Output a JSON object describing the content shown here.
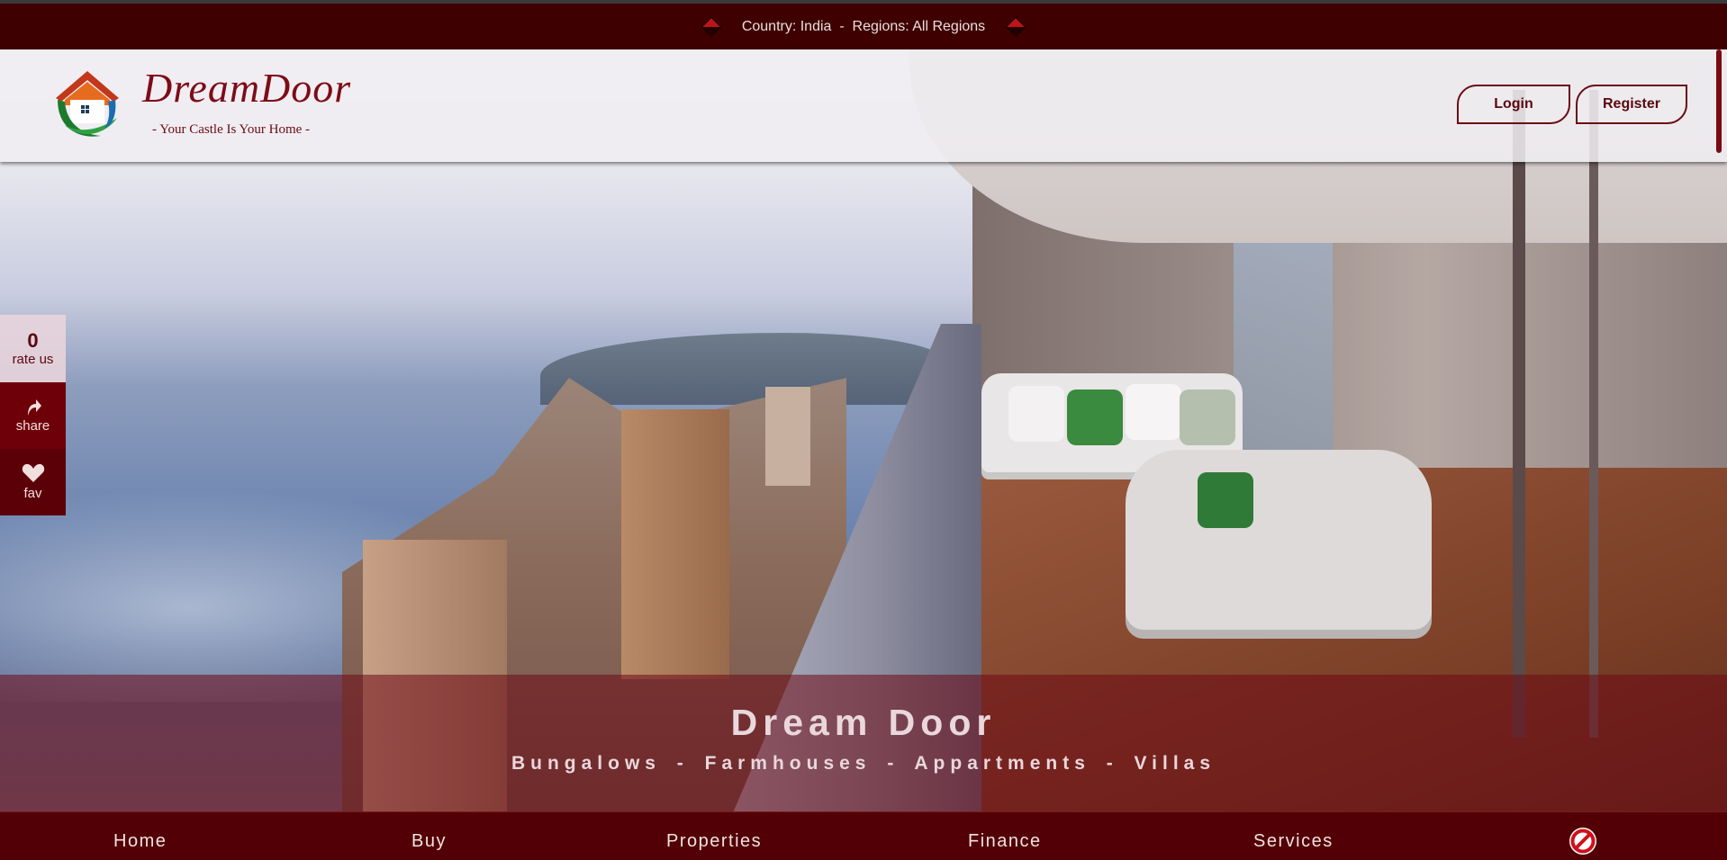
{
  "top_strip": {
    "text": "Country: India  -  Regions: All Regions"
  },
  "header": {
    "brand": "DreamDoor",
    "tagline": "- Your Castle Is Your Home -",
    "login_label": "Login",
    "register_label": "Register"
  },
  "side_widget": {
    "rating_count": "0",
    "rate_label": "rate us",
    "share_label": "share",
    "fav_label": "fav",
    "icons": [
      "share-arrow-icon",
      "heart-icon"
    ]
  },
  "hero": {
    "title": "Dream Door",
    "subtitle": "Bungalows - Farmhouses - Appartments - Villas"
  },
  "nav": {
    "items": [
      {
        "label": "Home"
      },
      {
        "label": "Buy"
      },
      {
        "label": "Properties"
      },
      {
        "label": "Finance"
      },
      {
        "label": "Services"
      }
    ],
    "end_icon": "no-entry-icon"
  },
  "colors": {
    "brand_dark": "#3e0000",
    "brand_accent": "#7d0c16",
    "nav_bg": "#520005",
    "caption_overlay": "rgba(110,10,22,0.55)"
  }
}
